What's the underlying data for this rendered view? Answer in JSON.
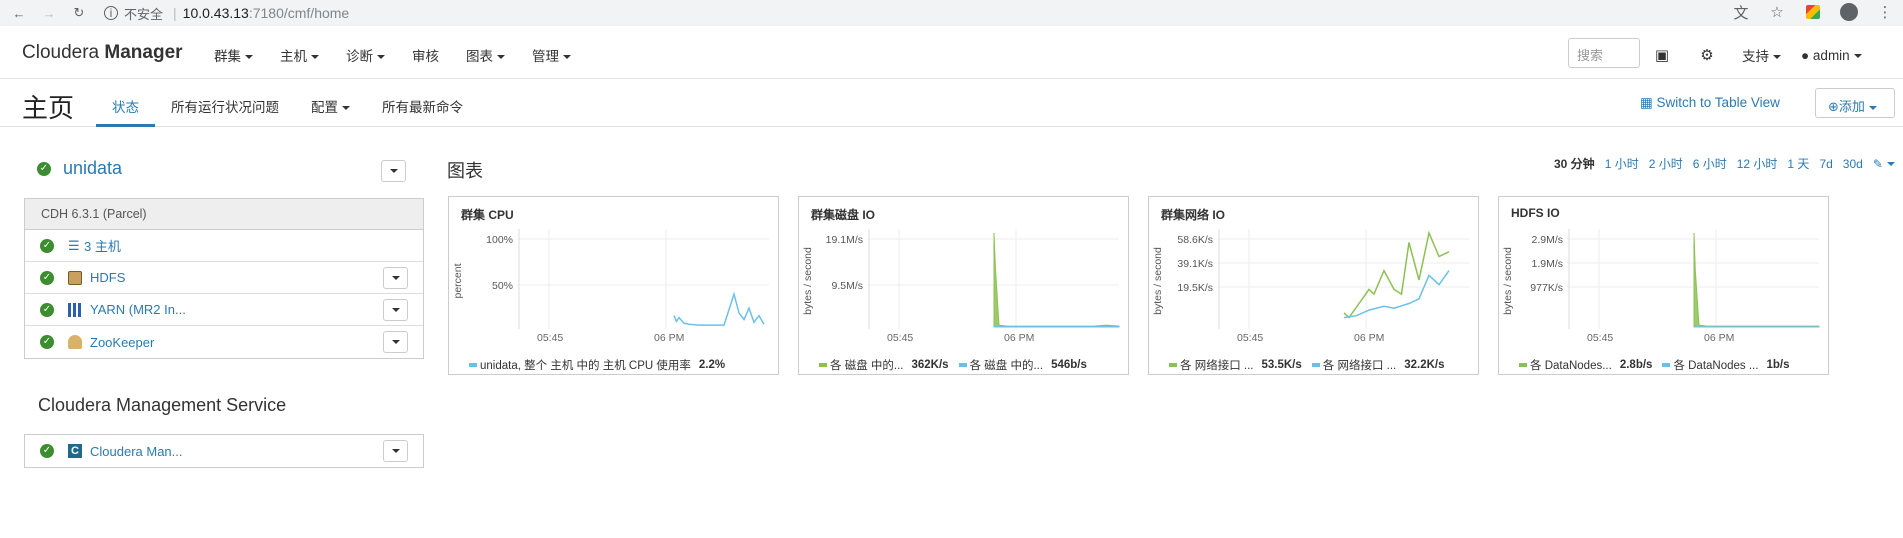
{
  "browser": {
    "security_label": "不安全",
    "url_host": "10.0.43.13",
    "url_path": ":7180/cmf/home"
  },
  "topnav": {
    "brand_light": "Cloudera",
    "brand_bold": "Manager",
    "menu": [
      "群集",
      "主机",
      "诊断",
      "审核",
      "图表",
      "管理"
    ],
    "search_placeholder": "搜索",
    "support_label": "支持",
    "user_label": "admin"
  },
  "page": {
    "title": "主页",
    "tabs": [
      "状态",
      "所有运行状况问题",
      "配置",
      "所有最新命令"
    ],
    "switch_view_label": "Switch to Table View",
    "add_label": "添加"
  },
  "cluster": {
    "name": "unidata",
    "version": "CDH 6.3.1 (Parcel)",
    "services": [
      {
        "label": "3 主机",
        "icon": "list-icon"
      },
      {
        "label": "HDFS",
        "icon": "hdfs-icon"
      },
      {
        "label": "YARN (MR2 In...",
        "icon": "yarn-icon"
      },
      {
        "label": "ZooKeeper",
        "icon": "zookeeper-icon"
      }
    ]
  },
  "cms": {
    "title": "Cloudera Management Service",
    "service_label": "Cloudera Man..."
  },
  "charts_section": {
    "title": "图表",
    "ranges": [
      "30 分钟",
      "1 小时",
      "2 小时",
      "6 小时",
      "12 小时",
      "1 天",
      "7d",
      "30d"
    ],
    "active_range": "30 分钟"
  },
  "colors": {
    "accent": "#2a7ab0",
    "ok_green": "#3c8d2f",
    "series_green": "#8cc152",
    "series_blue": "#6cc0e8"
  },
  "chart_data": [
    {
      "type": "line",
      "title": "群集 CPU",
      "ylabel": "percent",
      "y_ticks": [
        "100%",
        "50%"
      ],
      "x_ticks": [
        "05:45",
        "06 PM"
      ],
      "ylim": [
        0,
        100
      ],
      "series": [
        {
          "name": "unidata, 整个 主机 中的 主机 CPU 使用率",
          "color": "blue",
          "value_label": "2.2%",
          "x": [
            0.62,
            0.63,
            0.64,
            0.66,
            0.68,
            0.72,
            0.78,
            0.82,
            0.86,
            0.88,
            0.9,
            0.92,
            0.94,
            0.96,
            0.98
          ],
          "values": [
            12,
            6,
            10,
            4,
            3,
            2,
            2,
            2,
            35,
            15,
            8,
            20,
            5,
            12,
            3
          ]
        }
      ]
    },
    {
      "type": "area",
      "title": "群集磁盘 IO",
      "ylabel": "bytes / second",
      "y_ticks": [
        "19.1M/s",
        "9.5M/s"
      ],
      "x_ticks": [
        "05:45",
        "06 PM"
      ],
      "series": [
        {
          "name": "各 磁盘 中的...",
          "color": "green",
          "value_label": "362K/s",
          "x": [
            0.5,
            0.505,
            0.52,
            0.55,
            0.7,
            0.9,
            0.95,
            1.0
          ],
          "values": [
            1.0,
            0.65,
            0.02,
            0.01,
            0.01,
            0.01,
            0.02,
            0.01
          ]
        },
        {
          "name": "各 磁盘 中的...",
          "color": "blue",
          "value_label": "546b/s",
          "x": [
            0.5,
            0.7,
            1.0
          ],
          "values": [
            0.005,
            0.005,
            0.005
          ]
        }
      ]
    },
    {
      "type": "line",
      "title": "群集网络 IO",
      "ylabel": "bytes / second",
      "y_ticks": [
        "58.6K/s",
        "39.1K/s",
        "19.5K/s"
      ],
      "x_ticks": [
        "05:45",
        "06 PM"
      ],
      "series": [
        {
          "name": "各 网络接口 ...",
          "color": "green",
          "value_label": "53.5K/s",
          "x": [
            0.5,
            0.52,
            0.56,
            0.6,
            0.62,
            0.66,
            0.7,
            0.73,
            0.76,
            0.8,
            0.84,
            0.88,
            0.92
          ],
          "values": [
            0.15,
            0.1,
            0.25,
            0.4,
            0.35,
            0.6,
            0.4,
            0.35,
            0.9,
            0.5,
            1.0,
            0.75,
            0.8
          ]
        },
        {
          "name": "各 网络接口 ...",
          "color": "blue",
          "value_label": "32.2K/s",
          "x": [
            0.5,
            0.55,
            0.6,
            0.66,
            0.7,
            0.76,
            0.8,
            0.84,
            0.88,
            0.92
          ],
          "values": [
            0.1,
            0.12,
            0.18,
            0.22,
            0.2,
            0.25,
            0.3,
            0.55,
            0.45,
            0.6
          ]
        }
      ]
    },
    {
      "type": "area",
      "title": "HDFS IO",
      "ylabel": "bytes / second",
      "y_ticks": [
        "2.9M/s",
        "1.9M/s",
        "977K/s"
      ],
      "x_ticks": [
        "05:45",
        "06 PM"
      ],
      "series": [
        {
          "name": "各 DataNodes...",
          "color": "green",
          "value_label": "2.8b/s",
          "x": [
            0.5,
            0.505,
            0.52,
            0.55,
            0.7,
            0.9,
            1.0
          ],
          "values": [
            1.0,
            0.6,
            0.02,
            0.01,
            0.01,
            0.01,
            0.01
          ]
        },
        {
          "name": "各 DataNodes ...",
          "color": "blue",
          "value_label": "1b/s",
          "x": [
            0.5,
            1.0
          ],
          "values": [
            0.003,
            0.003
          ]
        }
      ]
    }
  ]
}
